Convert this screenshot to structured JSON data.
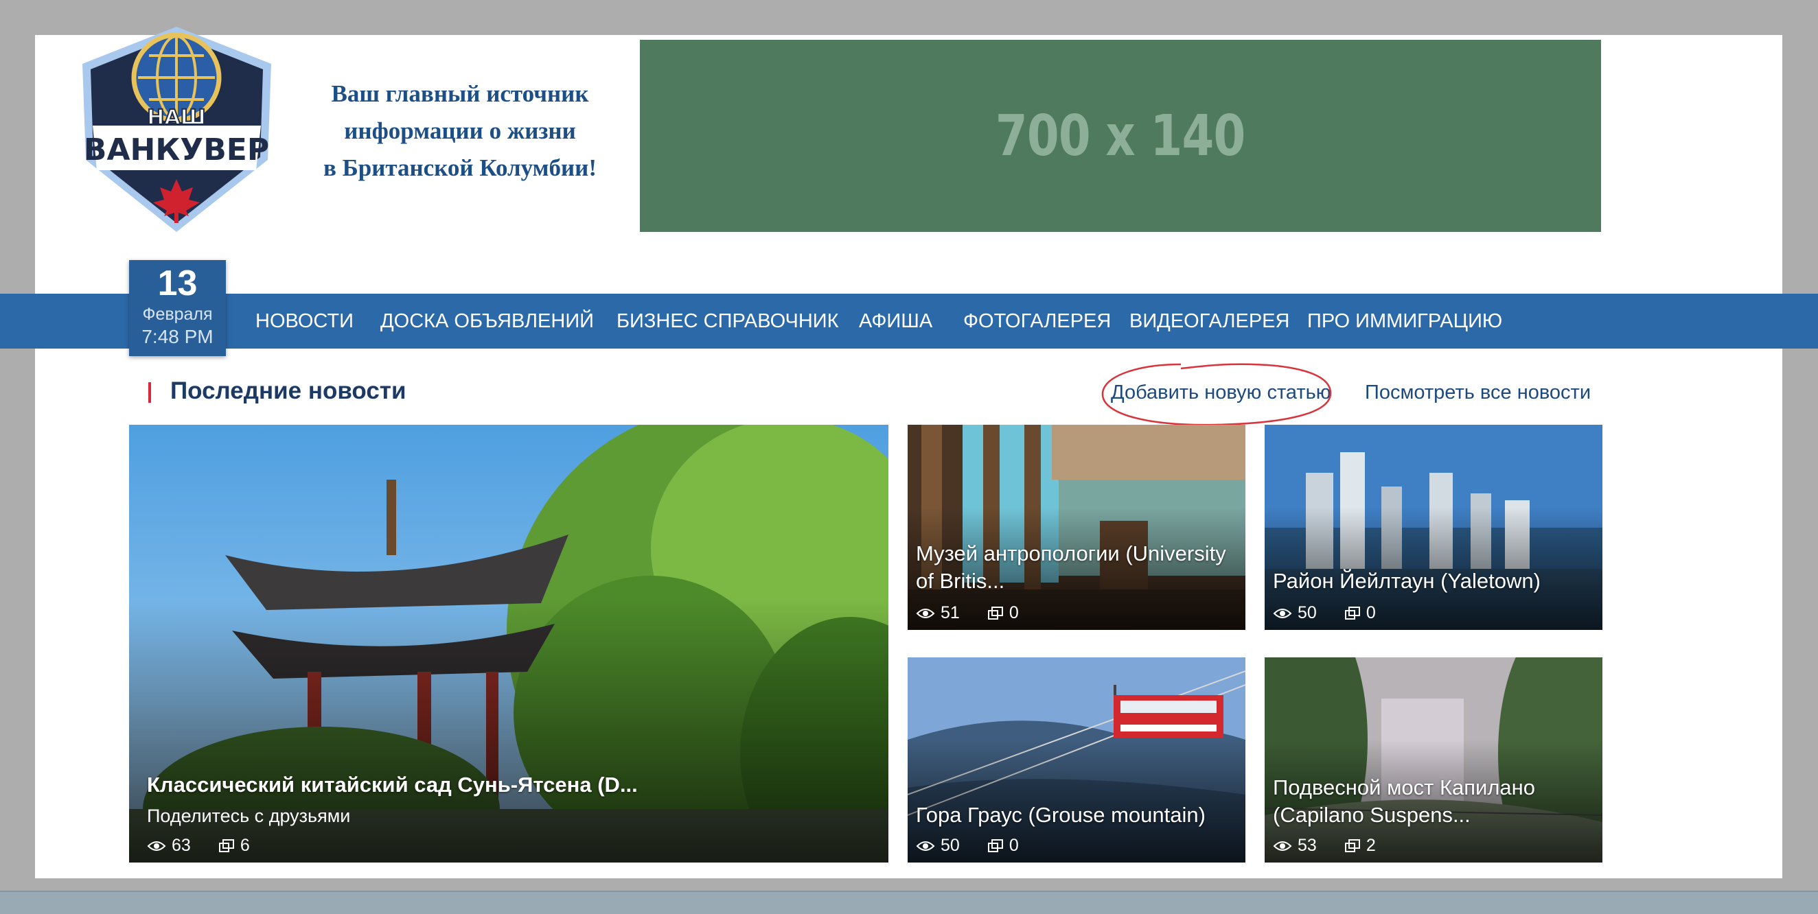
{
  "header": {
    "logo": {
      "line1": "НАШ",
      "line2": "ВАНКУВЕР"
    },
    "slogan": [
      "Ваш главный источник",
      "информации о жизни",
      "в Британской Колумбии!"
    ],
    "banner_text": "700 x 140"
  },
  "date": {
    "day": "13",
    "month": "Февраля",
    "time": "7:48 PM"
  },
  "nav": {
    "items": [
      {
        "label": "НОВОСТИ"
      },
      {
        "label": "ДОСКА ОБЪЯВЛЕНИЙ"
      },
      {
        "label": "БИЗНЕС СПРАВОЧНИК"
      },
      {
        "label": "АФИША"
      },
      {
        "label": "ФОТОГАЛЕРЕЯ"
      },
      {
        "label": "ВИДЕОГАЛЕРЕЯ"
      },
      {
        "label": "ПРО ИММИГРАЦИЮ"
      }
    ]
  },
  "news": {
    "title": "Последние новости",
    "add_link": "Добавить новую статью",
    "all_link": "Посмотреть все новости",
    "cards": [
      {
        "title": "Классический китайский сад Сунь-Ятсена (D...",
        "share": "Поделитесь с друзьями",
        "views": "63",
        "comments": "6"
      },
      {
        "title": "Музей антропологии (University of Britis...",
        "views": "51",
        "comments": "0"
      },
      {
        "title": "Район Йейлтаун (Yaletown)",
        "views": "50",
        "comments": "0"
      },
      {
        "title": "Гора Граус (Grouse mountain)",
        "views": "50",
        "comments": "0"
      },
      {
        "title": "Подвесной мост Капилано (Capilano Suspens...",
        "views": "53",
        "comments": "2"
      }
    ]
  },
  "colors": {
    "nav_bg": "#2c69a8",
    "date_bg": "#285f98",
    "banner_bg": "#4f7a5d",
    "link": "#1d4a7e",
    "accent_red": "#d8283a",
    "annotation_circle": "#d9333b"
  }
}
